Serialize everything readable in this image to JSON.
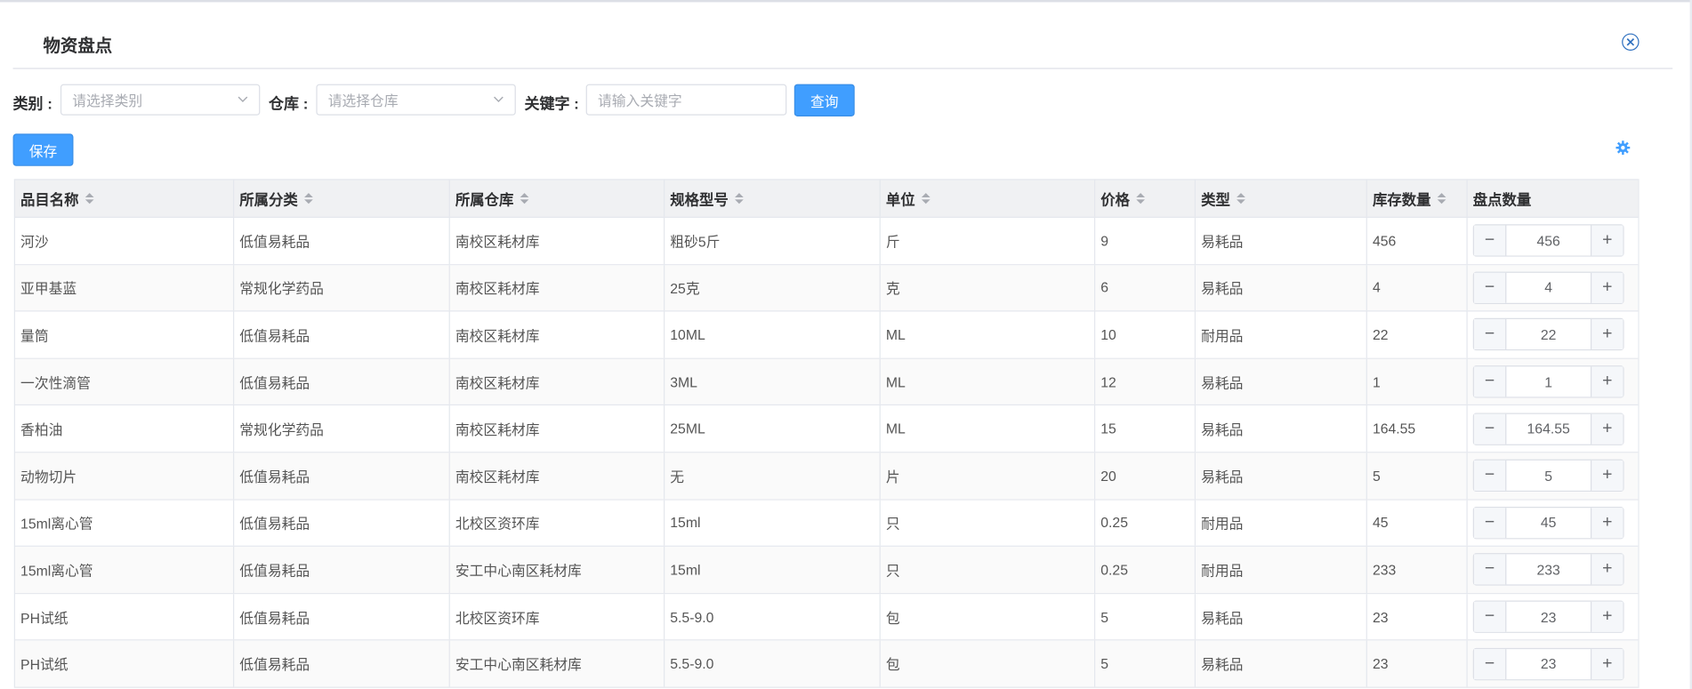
{
  "dialog": {
    "title": "物资盘点"
  },
  "filters": {
    "category_label": "类别 :",
    "category_placeholder": "请选择类别",
    "warehouse_label": "仓库 :",
    "warehouse_placeholder": "请选择仓库",
    "keyword_label": "关键字 :",
    "keyword_placeholder": "请输入关键字",
    "query_button": "查询"
  },
  "toolbar": {
    "save_button": "保存"
  },
  "table": {
    "columns": [
      "品目名称",
      "所属分类",
      "所属仓库",
      "规格型号",
      "单位",
      "价格",
      "类型",
      "库存数量",
      "盘点数量"
    ],
    "stepper": {
      "minus": "−",
      "plus": "+"
    },
    "rows": [
      {
        "name": "河沙",
        "category": "低值易耗品",
        "warehouse": "南校区耗材库",
        "spec": "粗砂5斤",
        "unit": "斤",
        "price": "9",
        "type": "易耗品",
        "stock": "456",
        "count": "456"
      },
      {
        "name": "亚甲基蓝",
        "category": "常规化学药品",
        "warehouse": "南校区耗材库",
        "spec": "25克",
        "unit": "克",
        "price": "6",
        "type": "易耗品",
        "stock": "4",
        "count": "4"
      },
      {
        "name": "量筒",
        "category": "低值易耗品",
        "warehouse": "南校区耗材库",
        "spec": "10ML",
        "unit": "ML",
        "price": "10",
        "type": "耐用品",
        "stock": "22",
        "count": "22"
      },
      {
        "name": "一次性滴管",
        "category": "低值易耗品",
        "warehouse": "南校区耗材库",
        "spec": "3ML",
        "unit": "ML",
        "price": "12",
        "type": "易耗品",
        "stock": "1",
        "count": "1"
      },
      {
        "name": "香柏油",
        "category": "常规化学药品",
        "warehouse": "南校区耗材库",
        "spec": "25ML",
        "unit": "ML",
        "price": "15",
        "type": "易耗品",
        "stock": "164.55",
        "count": "164.55"
      },
      {
        "name": "动物切片",
        "category": "低值易耗品",
        "warehouse": "南校区耗材库",
        "spec": "无",
        "unit": "片",
        "price": "20",
        "type": "易耗品",
        "stock": "5",
        "count": "5"
      },
      {
        "name": "15ml离心管",
        "category": "低值易耗品",
        "warehouse": "北校区资环库",
        "spec": "15ml",
        "unit": "只",
        "price": "0.25",
        "type": "耐用品",
        "stock": "45",
        "count": "45"
      },
      {
        "name": "15ml离心管",
        "category": "低值易耗品",
        "warehouse": "安工中心南区耗材库",
        "spec": "15ml",
        "unit": "只",
        "price": "0.25",
        "type": "耐用品",
        "stock": "233",
        "count": "233"
      },
      {
        "name": "PH试纸",
        "category": "低值易耗品",
        "warehouse": "北校区资环库",
        "spec": "5.5-9.0",
        "unit": "包",
        "price": "5",
        "type": "易耗品",
        "stock": "23",
        "count": "23"
      },
      {
        "name": "PH试纸",
        "category": "低值易耗品",
        "warehouse": "安工中心南区耗材库",
        "spec": "5.5-9.0",
        "unit": "包",
        "price": "5",
        "type": "易耗品",
        "stock": "23",
        "count": "23"
      }
    ]
  },
  "colors": {
    "primary": "#409eff",
    "header_bg": "#f0f1f3",
    "close_icon": "#2d6fbf"
  },
  "icons": {
    "close": "close-circle-icon",
    "settings": "gear-icon",
    "sort": "sort-icon",
    "dropdown": "chevron-down-icon"
  }
}
